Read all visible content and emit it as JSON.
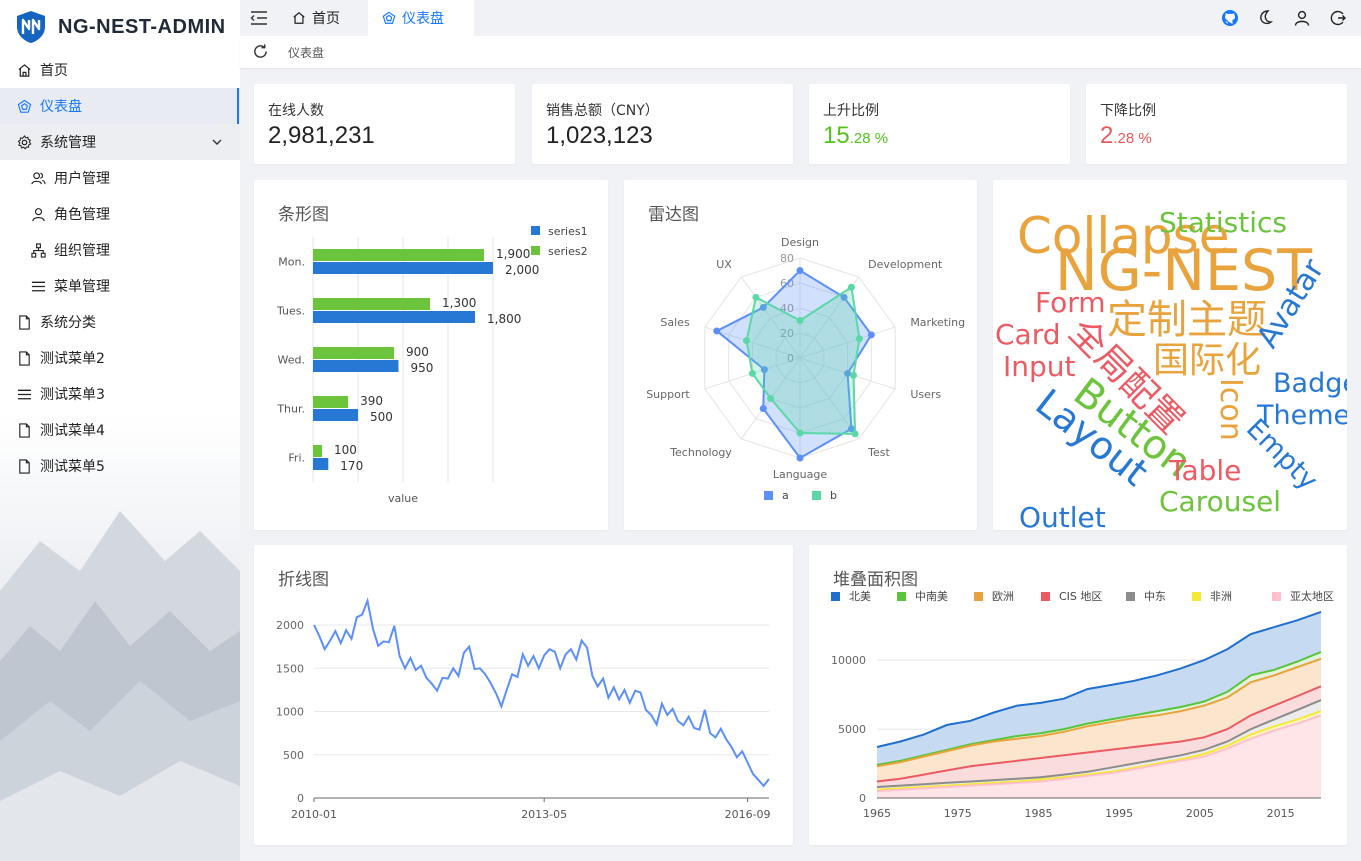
{
  "app": {
    "title": "NG-NEST-ADMIN"
  },
  "sidebar": {
    "items": [
      {
        "label": "首页",
        "icon": "home-icon"
      },
      {
        "label": "仪表盘",
        "icon": "dashboard-icon"
      },
      {
        "label": "系统管理",
        "icon": "gear-icon"
      },
      {
        "label": "用户管理",
        "icon": "users-icon"
      },
      {
        "label": "角色管理",
        "icon": "user-icon"
      },
      {
        "label": "组织管理",
        "icon": "org-icon"
      },
      {
        "label": "菜单管理",
        "icon": "menu-icon"
      },
      {
        "label": "系统分类",
        "icon": "file-icon"
      },
      {
        "label": "测试菜单2",
        "icon": "file-icon"
      },
      {
        "label": "测试菜单3",
        "icon": "menu-icon"
      },
      {
        "label": "测试菜单4",
        "icon": "file-icon"
      },
      {
        "label": "测试菜单5",
        "icon": "file-icon"
      }
    ]
  },
  "tabs": [
    {
      "label": "首页"
    },
    {
      "label": "仪表盘"
    }
  ],
  "breadcrumb": {
    "current": "仪表盘"
  },
  "stats": [
    {
      "label": "在线人数",
      "value": "2,981,231"
    },
    {
      "label": "销售总额（CNY）",
      "value": "1,023,123"
    },
    {
      "label": "上升比例",
      "int": "15",
      "frac": ".28 %"
    },
    {
      "label": "下降比例",
      "int": "2",
      "frac": ".28 %"
    }
  ],
  "colors": {
    "primary": "#1677ff",
    "up": "#52c41a",
    "down": "#e8585c"
  },
  "cards": {
    "bar_title": "条形图",
    "radar_title": "雷达图",
    "line_title": "折线图",
    "area_title": "堆叠面积图"
  },
  "chart_data": [
    {
      "type": "bar",
      "orientation": "horizontal",
      "categories": [
        "Mon.",
        "Tues.",
        "Wed.",
        "Thur.",
        "Fri."
      ],
      "series": [
        {
          "name": "series1",
          "values": [
            2000,
            1800,
            950,
            500,
            170
          ],
          "color": "#2778d4"
        },
        {
          "name": "series2",
          "values": [
            1900,
            1300,
            900,
            390,
            100
          ],
          "color": "#6cc33c"
        }
      ],
      "value_labels": [
        [
          "2,000",
          "1,800",
          "950",
          "500",
          "170"
        ],
        [
          "1,900",
          "1,300",
          "900",
          "390",
          "100"
        ]
      ],
      "xlabel": "value",
      "xlim": [
        0,
        2000
      ],
      "legend": "top-right"
    },
    {
      "type": "radar",
      "indicators": [
        "Design",
        "Development",
        "Marketing",
        "Users",
        "Test",
        "Language",
        "Technology",
        "Support",
        "Sales",
        "UX"
      ],
      "rings": [
        "0",
        "20",
        "40",
        "60",
        "80"
      ],
      "max": 80,
      "series": [
        {
          "name": "a",
          "values": [
            70,
            60,
            60,
            40,
            70,
            80,
            50,
            30,
            70,
            50
          ],
          "color": "#5b8ff9"
        },
        {
          "name": "b",
          "values": [
            30,
            70,
            50,
            45,
            75,
            60,
            40,
            40,
            45,
            60
          ],
          "color": "#5ad8a6"
        }
      ],
      "legend": "bottom"
    },
    {
      "type": "line",
      "x_ticks": [
        "2010-01",
        "2013-05",
        "2016-09"
      ],
      "y_ticks": [
        "0",
        "500",
        "1000",
        "1500",
        "2000"
      ],
      "ylim": [
        0,
        2000
      ],
      "values": [
        2000,
        1870,
        1720,
        1820,
        1930,
        1790,
        1940,
        1840,
        2090,
        2120,
        2280,
        1960,
        1760,
        1810,
        1800,
        1990,
        1640,
        1500,
        1620,
        1480,
        1530,
        1390,
        1320,
        1240,
        1390,
        1380,
        1500,
        1410,
        1680,
        1750,
        1490,
        1500,
        1430,
        1330,
        1210,
        1060,
        1250,
        1430,
        1400,
        1660,
        1530,
        1640,
        1500,
        1650,
        1720,
        1690,
        1500,
        1660,
        1720,
        1600,
        1820,
        1740,
        1410,
        1290,
        1380,
        1160,
        1280,
        1140,
        1250,
        1100,
        1240,
        1220,
        1020,
        960,
        850,
        1090,
        960,
        1030,
        890,
        840,
        940,
        810,
        790,
        1020,
        750,
        700,
        800,
        680,
        590,
        470,
        540,
        410,
        280,
        210,
        140,
        220
      ],
      "color": "#5b8ff9"
    },
    {
      "type": "area",
      "stacked": true,
      "x_ticks": [
        "1965",
        "1975",
        "1985",
        "1995",
        "2005",
        "2015"
      ],
      "y_ticks": [
        "0",
        "5000",
        "10000"
      ],
      "ylim": [
        0,
        14000
      ],
      "series": [
        {
          "name": "北美",
          "color": "#1f6fcf",
          "fill": "#c6dbf2",
          "values": [
            3700,
            4100,
            4600,
            5300,
            5600,
            6200,
            6700,
            6900,
            7200,
            7900,
            8200,
            8500,
            8900,
            9400,
            10000,
            10800,
            11900,
            12400,
            12900,
            13500
          ]
        },
        {
          "name": "中南美",
          "color": "#5ac43c",
          "fill": "#e3f3dc",
          "values": [
            2400,
            2700,
            3100,
            3500,
            3900,
            4200,
            4500,
            4700,
            5000,
            5400,
            5700,
            6000,
            6300,
            6600,
            7000,
            7700,
            8900,
            9300,
            9900,
            10600
          ]
        },
        {
          "name": "欧洲",
          "color": "#e8a33c",
          "fill": "#fbe6cd",
          "values": [
            2300,
            2600,
            3000,
            3400,
            3800,
            4100,
            4300,
            4500,
            4800,
            5200,
            5500,
            5800,
            6000,
            6300,
            6700,
            7300,
            8400,
            8900,
            9500,
            10100
          ]
        },
        {
          "name": "CIS 地区",
          "color": "#ec5b63",
          "fill": "#fbdcdc",
          "values": [
            1200,
            1400,
            1700,
            2000,
            2300,
            2500,
            2700,
            2900,
            3100,
            3300,
            3500,
            3700,
            3900,
            4100,
            4400,
            5000,
            6000,
            6700,
            7400,
            8100
          ]
        },
        {
          "name": "中东",
          "color": "#8c8c8c",
          "fill": "#ececec",
          "values": [
            800,
            900,
            1000,
            1100,
            1200,
            1300,
            1400,
            1500,
            1700,
            1900,
            2200,
            2500,
            2800,
            3100,
            3500,
            4100,
            5000,
            5700,
            6400,
            7100
          ]
        },
        {
          "name": "非洲",
          "color": "#f5e836",
          "fill": "#fbf6c6",
          "values": [
            600,
            700,
            800,
            900,
            1000,
            1100,
            1200,
            1350,
            1500,
            1700,
            1900,
            2200,
            2500,
            2800,
            3200,
            3800,
            4600,
            5200,
            5700,
            6300
          ]
        },
        {
          "name": "亚太地区",
          "color": "#ffc0cb",
          "fill": "#ffe4e8",
          "values": [
            500,
            600,
            700,
            800,
            900,
            1000,
            1100,
            1200,
            1400,
            1600,
            1800,
            2100,
            2400,
            2700,
            3000,
            3600,
            4300,
            4900,
            5400,
            6000
          ]
        }
      ],
      "legend": "top"
    }
  ],
  "wordcloud": [
    {
      "text": "Collapse",
      "color": "#e8a33c"
    },
    {
      "text": "Statistics",
      "color": "#6cc33c"
    },
    {
      "text": "NG-NEST",
      "color": "#e8a33c"
    },
    {
      "text": "Form",
      "color": "#ec5b63"
    },
    {
      "text": "定制主题",
      "color": "#e8a33c"
    },
    {
      "text": "Avatar",
      "color": "#2778d4"
    },
    {
      "text": "Card",
      "color": "#ec5b63"
    },
    {
      "text": "全局配置",
      "color": "#ec5b63"
    },
    {
      "text": "国际化",
      "color": "#e8a33c"
    },
    {
      "text": "Input",
      "color": "#ec5b63"
    },
    {
      "text": "Badge",
      "color": "#2778d4"
    },
    {
      "text": "Icon",
      "color": "#e8a33c"
    },
    {
      "text": "Theme",
      "color": "#2778d4"
    },
    {
      "text": "Button",
      "color": "#6cc33c"
    },
    {
      "text": "Layout",
      "color": "#2778d4"
    },
    {
      "text": "Empty",
      "color": "#2778d4"
    },
    {
      "text": "Table",
      "color": "#ec5b63"
    },
    {
      "text": "Carousel",
      "color": "#6cc33c"
    },
    {
      "text": "Outlet",
      "color": "#2778d4"
    }
  ]
}
